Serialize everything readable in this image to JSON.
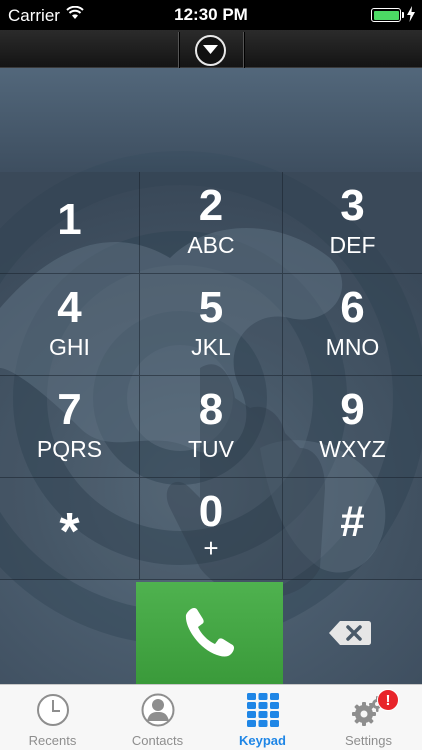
{
  "status_bar": {
    "carrier": "Carrier",
    "time": "12:30 PM",
    "battery_level": 1.0,
    "charging": true
  },
  "toolbar": {
    "collapse_icon": "chevron-down-circle-icon"
  },
  "display": {
    "number": ""
  },
  "keypad": {
    "keys": [
      {
        "digit": "1",
        "letters": ""
      },
      {
        "digit": "2",
        "letters": "ABC"
      },
      {
        "digit": "3",
        "letters": "DEF"
      },
      {
        "digit": "4",
        "letters": "GHI"
      },
      {
        "digit": "5",
        "letters": "JKL"
      },
      {
        "digit": "6",
        "letters": "MNO"
      },
      {
        "digit": "7",
        "letters": "PQRS"
      },
      {
        "digit": "8",
        "letters": "TUV"
      },
      {
        "digit": "9",
        "letters": "WXYZ"
      },
      {
        "digit": "*",
        "letters": ""
      },
      {
        "digit": "0",
        "letters": "+"
      },
      {
        "digit": "#",
        "letters": ""
      }
    ],
    "call_icon": "phone-icon",
    "backspace_icon": "backspace-icon",
    "call_color": "#43a843"
  },
  "tabs": [
    {
      "label": "Recents",
      "icon": "clock-icon",
      "active": false
    },
    {
      "label": "Contacts",
      "icon": "person-icon",
      "active": false
    },
    {
      "label": "Keypad",
      "icon": "keypad-grid-icon",
      "active": true
    },
    {
      "label": "Settings",
      "icon": "gears-icon",
      "active": false,
      "badge": "!"
    }
  ],
  "colors": {
    "accent": "#1f86e6",
    "badge": "#e8242a"
  }
}
